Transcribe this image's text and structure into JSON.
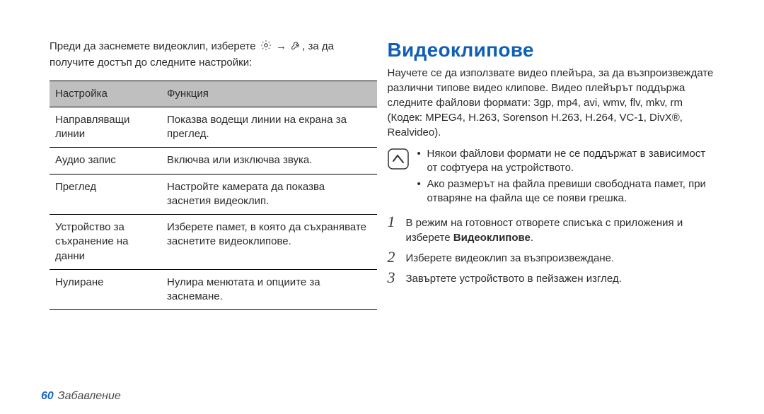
{
  "left": {
    "intro_pre": "Преди да заснемете видеоклип, изберете ",
    "intro_mid": " → ",
    "intro_post": " за да получите достъп до следните настройки:",
    "icon_gear": "gear-icon",
    "icon_tool": "wrench-icon",
    "table": {
      "header": {
        "c1": "Настройка",
        "c2": "Функция"
      },
      "rows": [
        {
          "c1": "Направляващи линии",
          "c2": "Показва водещи линии на екрана за преглед."
        },
        {
          "c1": "Аудио запис",
          "c2": "Включва или изключва звука."
        },
        {
          "c1": "Преглед",
          "c2": "Настройте камерата да показва заснетия видеоклип."
        },
        {
          "c1": "Устройство за съхранение на данни",
          "c2": "Изберете памет, в която да съхранявате заснетите видеоклипове."
        },
        {
          "c1": "Нулиране",
          "c2": "Нулира менютата и опциите за заснемане."
        }
      ]
    }
  },
  "right": {
    "title": "Видеоклипове",
    "desc": "Научете се да използвате видео плейъра, за да възпроизвеждате различни типове видео клипове. Видео плейърът поддържа следните файлови формати: 3gp, mp4, avi, wmv, flv, mkv, rm (Кодек: MPEG4, H.263, Sorenson H.263, H.264, VC-1, DivX®, Realvideo).",
    "notes": [
      "Някои файлови формати не се поддържат в зависимост от софтуера на устройството.",
      "Ако размерът на файла превиши свободната памет, при отваряне на файла ще се появи грешка."
    ],
    "steps": [
      {
        "n": "1",
        "pre": "В режим на готовност отворете списъка с приложения и изберете ",
        "bold": "Видеоклипове",
        "post": "."
      },
      {
        "n": "2",
        "pre": "Изберете видеоклип за възпроизвеждане.",
        "bold": "",
        "post": ""
      },
      {
        "n": "3",
        "pre": "Завъртете устройството в пейзажен изглед.",
        "bold": "",
        "post": ""
      }
    ]
  },
  "footer": {
    "page": "60",
    "section": "Забавление"
  }
}
